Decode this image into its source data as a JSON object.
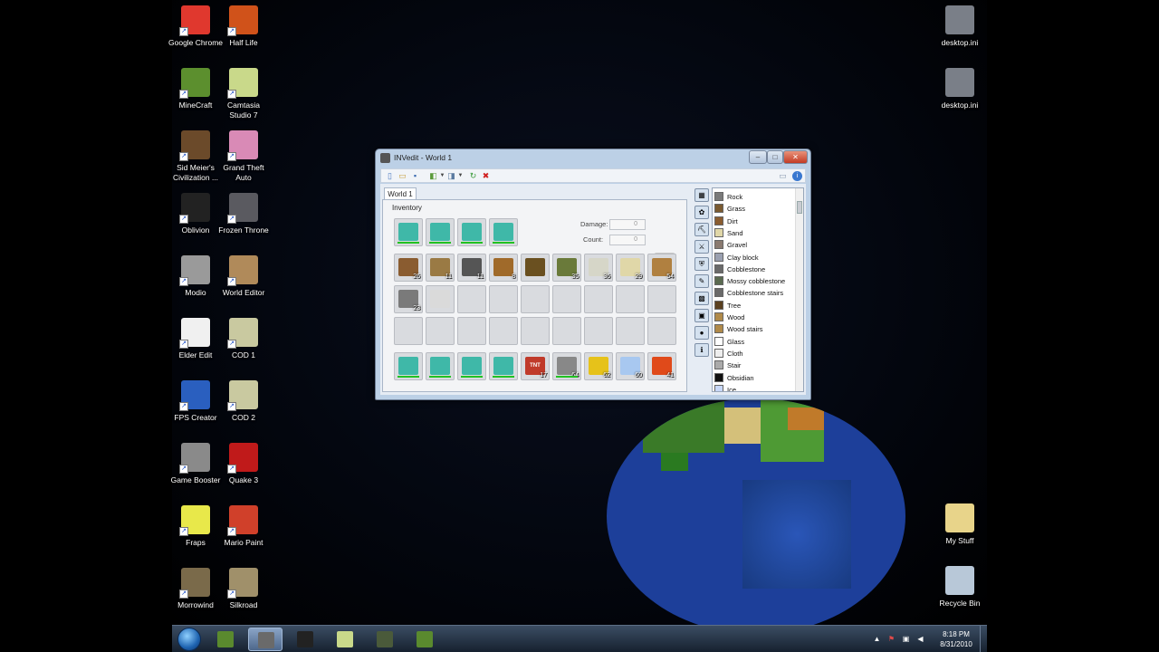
{
  "desktop_icons": [
    {
      "label": "Google Chrome",
      "icon": "chrome-icon",
      "color": "#e0382e"
    },
    {
      "label": "Half Life",
      "icon": "half-life-icon",
      "color": "#d0521a"
    },
    {
      "label": "MineCraft",
      "icon": "minecraft-icon",
      "color": "#5c8f2e"
    },
    {
      "label": "Camtasia Studio 7",
      "icon": "camtasia-icon",
      "color": "#c9d98a"
    },
    {
      "label": "Sid Meier's Civilization ...",
      "icon": "civilization-icon",
      "color": "#6b4a2a"
    },
    {
      "label": "Grand Theft Auto",
      "icon": "gta-icon",
      "color": "#d98ab6"
    },
    {
      "label": "Oblivion",
      "icon": "oblivion-icon",
      "color": "#222222"
    },
    {
      "label": "Frozen Throne",
      "icon": "frozen-throne-icon",
      "color": "#5a5a60"
    },
    {
      "label": "Modio",
      "icon": "modio-icon",
      "color": "#9a9a9a"
    },
    {
      "label": "World Editor",
      "icon": "world-editor-icon",
      "color": "#b08a5a"
    },
    {
      "label": "Elder Edit",
      "icon": "elder-edit-icon",
      "color": "#f0f0f0"
    },
    {
      "label": "COD 1",
      "icon": "cod-icon",
      "color": "#c9c9a0"
    },
    {
      "label": "FPS Creator",
      "icon": "fps-creator-icon",
      "color": "#2a5fbf"
    },
    {
      "label": "COD 2",
      "icon": "cod2-icon",
      "color": "#c9c9a0"
    },
    {
      "label": "Game Booster",
      "icon": "game-booster-icon",
      "color": "#8a8a8a"
    },
    {
      "label": "Quake 3",
      "icon": "quake-icon",
      "color": "#c01a1a"
    },
    {
      "label": "Fraps",
      "icon": "fraps-icon",
      "color": "#e8e84a"
    },
    {
      "label": "Mario Paint",
      "icon": "mario-paint-icon",
      "color": "#d0402a"
    },
    {
      "label": "Morrowind",
      "icon": "morrowind-icon",
      "color": "#7a6a4a"
    },
    {
      "label": "Silkroad",
      "icon": "silkroad-icon",
      "color": "#a0906a"
    }
  ],
  "right_icons": [
    {
      "label": "desktop.ini",
      "icon": "file-icon"
    },
    {
      "label": "desktop.ini",
      "icon": "file-icon"
    },
    {
      "label": "My Stuff",
      "icon": "folder-icon"
    },
    {
      "label": "Recycle Bin",
      "icon": "recycle-bin-icon"
    }
  ],
  "window": {
    "title": "INVedit - World 1",
    "tab": "World 1",
    "group_label": "Inventory",
    "damage_label": "Damage:",
    "count_label": "Count:",
    "damage_value": "0",
    "count_value": "0"
  },
  "armor": [
    {
      "name": "helmet-item",
      "color": "#3fb8a8"
    },
    {
      "name": "chestplate-item",
      "color": "#3fb8a8"
    },
    {
      "name": "leggings-item",
      "color": "#3fb8a8"
    },
    {
      "name": "boots-item",
      "color": "#3fb8a8"
    }
  ],
  "inventory_rows": [
    [
      {
        "name": "dirt-item",
        "color": "#8a5c30",
        "count": "26"
      },
      {
        "name": "bookshelf-item",
        "color": "#9a7a44",
        "count": "11"
      },
      {
        "name": "furnace-item",
        "color": "#555555",
        "count": "11"
      },
      {
        "name": "chest-item",
        "color": "#a06a2a",
        "count": "8"
      },
      {
        "name": "log-item",
        "color": "#6a5020",
        "count": ""
      },
      {
        "name": "sign-item",
        "color": "#6a7a3a",
        "count": "35"
      },
      {
        "name": "torch-item",
        "color": "#d6d6c8",
        "count": "36"
      },
      {
        "name": "sand-item",
        "color": "#e0d7a8",
        "count": "29"
      },
      {
        "name": "ladder-item",
        "color": "#b08040",
        "count": "54"
      }
    ],
    [
      {
        "name": "gravel-item",
        "color": "#7a7a7a",
        "count": "23"
      },
      {
        "name": "feather-item",
        "color": "#dadada",
        "count": ""
      },
      {
        "name": "empty-slot",
        "color": "",
        "count": ""
      },
      {
        "name": "empty-slot",
        "color": "",
        "count": ""
      },
      {
        "name": "empty-slot",
        "color": "",
        "count": ""
      },
      {
        "name": "empty-slot",
        "color": "",
        "count": ""
      },
      {
        "name": "empty-slot",
        "color": "",
        "count": ""
      },
      {
        "name": "empty-slot",
        "color": "",
        "count": ""
      },
      {
        "name": "empty-slot",
        "color": "",
        "count": ""
      }
    ],
    [
      {
        "name": "empty-slot",
        "color": "",
        "count": ""
      },
      {
        "name": "empty-slot",
        "color": "",
        "count": ""
      },
      {
        "name": "empty-slot",
        "color": "",
        "count": ""
      },
      {
        "name": "empty-slot",
        "color": "",
        "count": ""
      },
      {
        "name": "empty-slot",
        "color": "",
        "count": ""
      },
      {
        "name": "empty-slot",
        "color": "",
        "count": ""
      },
      {
        "name": "empty-slot",
        "color": "",
        "count": ""
      },
      {
        "name": "empty-slot",
        "color": "",
        "count": ""
      },
      {
        "name": "empty-slot",
        "color": "",
        "count": ""
      }
    ],
    [
      {
        "name": "diamond-sword-item",
        "color": "#3fb8a8",
        "count": ""
      },
      {
        "name": "diamond-pickaxe-item",
        "color": "#3fb8a8",
        "count": ""
      },
      {
        "name": "diamond-axe-item",
        "color": "#3fb8a8",
        "count": ""
      },
      {
        "name": "diamond-shovel-item",
        "color": "#3fb8a8",
        "count": ""
      },
      {
        "name": "tnt-item",
        "color": "#c03a2a",
        "count": "17",
        "text": "TNT"
      },
      {
        "name": "flint-and-steel-item",
        "color": "#888888",
        "count": "64"
      },
      {
        "name": "golden-apple-item",
        "color": "#e6c21a",
        "count": "62"
      },
      {
        "name": "ice-item",
        "color": "#a8c8f0",
        "count": "60"
      },
      {
        "name": "lava-item",
        "color": "#e04a1a",
        "count": "41"
      }
    ]
  ],
  "categories": [
    "block-category-icon",
    "plant-category-icon",
    "tool-category-icon",
    "weapon-category-icon",
    "armor-category-icon",
    "food-category-icon",
    "mineral-category-icon",
    "chest-category-icon",
    "misc-category-icon",
    "info-category-icon"
  ],
  "block_list": [
    {
      "label": "Rock",
      "color": "#7a7a7a"
    },
    {
      "label": "Grass",
      "color": "#7a5a30"
    },
    {
      "label": "Dirt",
      "color": "#8a5c30"
    },
    {
      "label": "Sand",
      "color": "#e0d7a8"
    },
    {
      "label": "Gravel",
      "color": "#8a7a70"
    },
    {
      "label": "Clay block",
      "color": "#9aa0b0"
    },
    {
      "label": "Cobblestone",
      "color": "#6a6a6a"
    },
    {
      "label": "Mossy cobblestone",
      "color": "#5a6a50"
    },
    {
      "label": "Cobblestone stairs",
      "color": "#6a6a6a"
    },
    {
      "label": "Tree",
      "color": "#5a4020"
    },
    {
      "label": "Wood",
      "color": "#b08a4a"
    },
    {
      "label": "Wood stairs",
      "color": "#b08a4a"
    },
    {
      "label": "Glass",
      "color": "#ffffff"
    },
    {
      "label": "Cloth",
      "color": "#eeeeee"
    },
    {
      "label": "Stair",
      "color": "#aaaaaa"
    },
    {
      "label": "Obsidian",
      "color": "#111111"
    },
    {
      "label": "Ice",
      "color": "#c8d8f8"
    }
  ],
  "taskbar": {
    "apps": [
      "minecraft-task-icon",
      "invedit-task-icon",
      "oblivion-task-icon",
      "camtasia-task-icon",
      "video-task-icon",
      "minecraft2-task-icon"
    ],
    "time": "8:18 PM",
    "date": "8/31/2010"
  }
}
